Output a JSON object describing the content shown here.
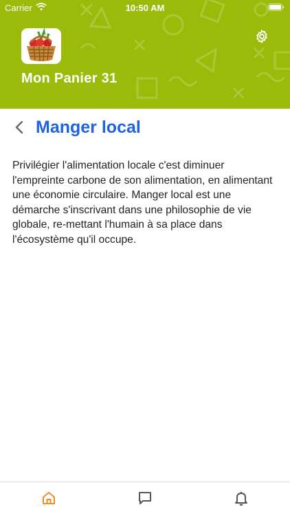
{
  "status_bar": {
    "carrier": "Carrier",
    "time": "10:50 AM"
  },
  "header": {
    "app_title": "Mon Panier 31",
    "logo_icon": "vegetable-basket-icon",
    "settings_icon": "gear-icon",
    "background_color": "#9bbb0a"
  },
  "page": {
    "title": "Manger local",
    "back_icon": "chevron-left-icon",
    "title_color": "#1f63e0",
    "body": "Privilégier l'alimentation locale c'est diminuer l'empreinte carbone de son alimentation, en alimentant une économie circulaire. Manger local est une démarche s'inscrivant dans une philosophie de vie globale, re-mettant l'humain à sa place dans l'écosystème qu'il occupe."
  },
  "tab_bar": {
    "items": [
      {
        "icon": "home-icon",
        "active": true
      },
      {
        "icon": "chat-bubble-icon",
        "active": false
      },
      {
        "icon": "bell-icon",
        "active": false
      }
    ],
    "active_color": "#f08c28",
    "inactive_color": "#555555"
  }
}
